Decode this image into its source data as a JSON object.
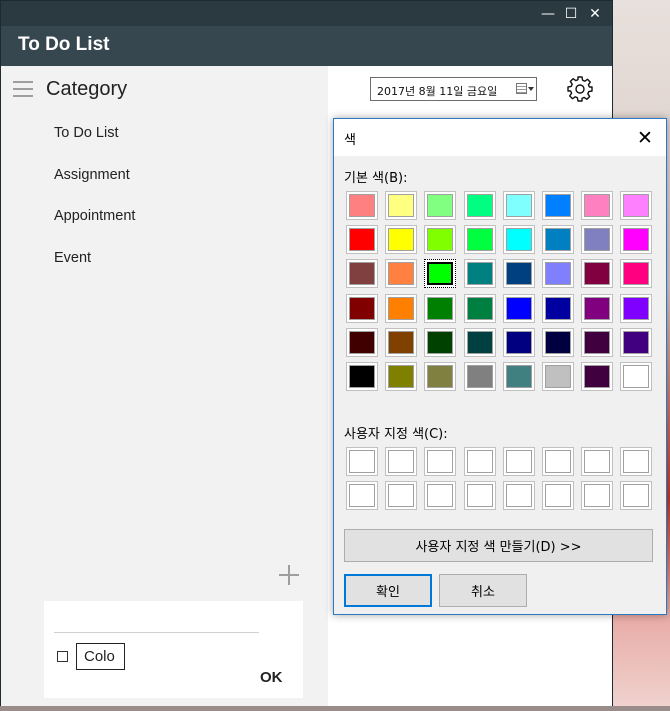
{
  "window": {
    "controls": {
      "minimize": "—",
      "maximize": "☐",
      "close": "✕"
    }
  },
  "app": {
    "title": "To Do List"
  },
  "sidebar": {
    "title": "Category",
    "items": [
      {
        "label": "To Do List"
      },
      {
        "label": "Assignment"
      },
      {
        "label": "Appointment"
      },
      {
        "label": "Event"
      }
    ],
    "panel": {
      "input_value": "Colo",
      "ok_label": "OK"
    }
  },
  "main": {
    "date": "2017년  8월  11일 금요일"
  },
  "dialog": {
    "title": "색",
    "close": "✕",
    "basic_label": "기본 색(B):",
    "custom_label": "사용자 지정 색(C):",
    "define_button": "사용자 지정 색 만들기(D) >>",
    "ok_button": "확인",
    "cancel_button": "취소",
    "selected_index": 18,
    "basic_colors": [
      "#ff8080",
      "#ffff80",
      "#80ff80",
      "#00ff80",
      "#80ffff",
      "#0080ff",
      "#ff80c0",
      "#ff80ff",
      "#ff0000",
      "#ffff00",
      "#80ff00",
      "#00ff40",
      "#00ffff",
      "#0080c0",
      "#8080c0",
      "#ff00ff",
      "#804040",
      "#ff8040",
      "#00ff00",
      "#008080",
      "#004080",
      "#8080ff",
      "#800040",
      "#ff0080",
      "#800000",
      "#ff8000",
      "#008000",
      "#008040",
      "#0000ff",
      "#0000a0",
      "#800080",
      "#8000ff",
      "#400000",
      "#804000",
      "#004000",
      "#004040",
      "#000080",
      "#000040",
      "#400040",
      "#400080",
      "#000000",
      "#808000",
      "#808040",
      "#808080",
      "#408080",
      "#c0c0c0",
      "#400040",
      "#ffffff"
    ],
    "custom_colors": [
      "#ffffff",
      "#ffffff",
      "#ffffff",
      "#ffffff",
      "#ffffff",
      "#ffffff",
      "#ffffff",
      "#ffffff",
      "#ffffff",
      "#ffffff",
      "#ffffff",
      "#ffffff",
      "#ffffff",
      "#ffffff",
      "#ffffff",
      "#ffffff"
    ]
  }
}
